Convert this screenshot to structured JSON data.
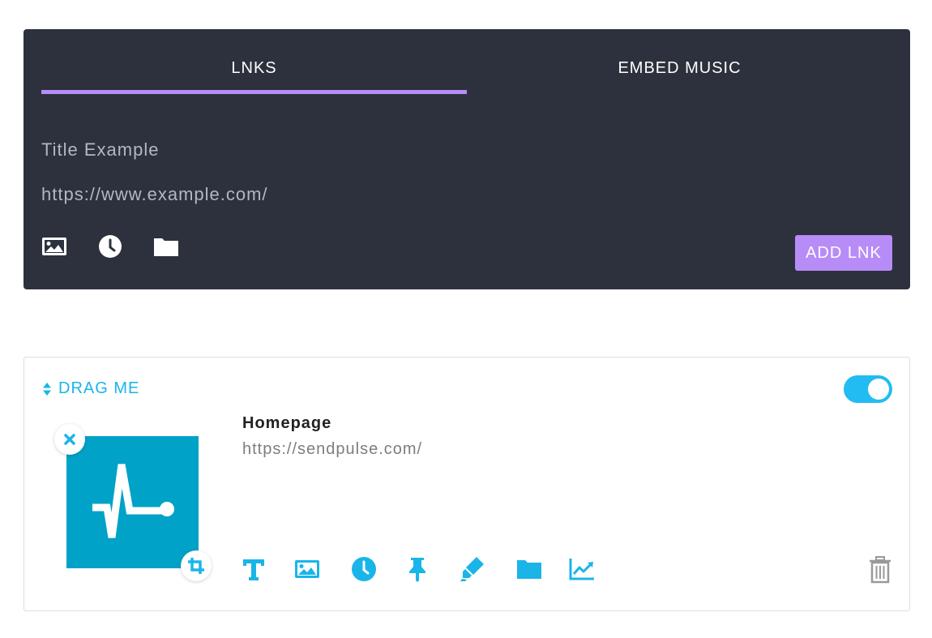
{
  "tabs": [
    {
      "label": "LNKS",
      "active": true
    },
    {
      "label": "EMBED MUSIC",
      "active": false
    }
  ],
  "form": {
    "title_placeholder": "Title Example",
    "url_placeholder": "https://www.example.com/",
    "icons": [
      "image-icon",
      "clock-icon",
      "folder-icon"
    ],
    "add_button_label": "ADD LNK"
  },
  "link_card": {
    "drag_label": "DRAG ME",
    "enabled": true,
    "title": "Homepage",
    "url": "https://sendpulse.com/",
    "tool_icons": [
      "text-icon",
      "image-icon",
      "clock-icon",
      "pin-icon",
      "highlighter-icon",
      "folder-icon",
      "chart-icon"
    ],
    "delete_icon": "trash-icon"
  },
  "colors": {
    "panel_bg": "#2c313d",
    "accent_purple": "#b88cf7",
    "accent_blue": "#1ab5e8",
    "thumb_bg": "#00a2c7"
  }
}
